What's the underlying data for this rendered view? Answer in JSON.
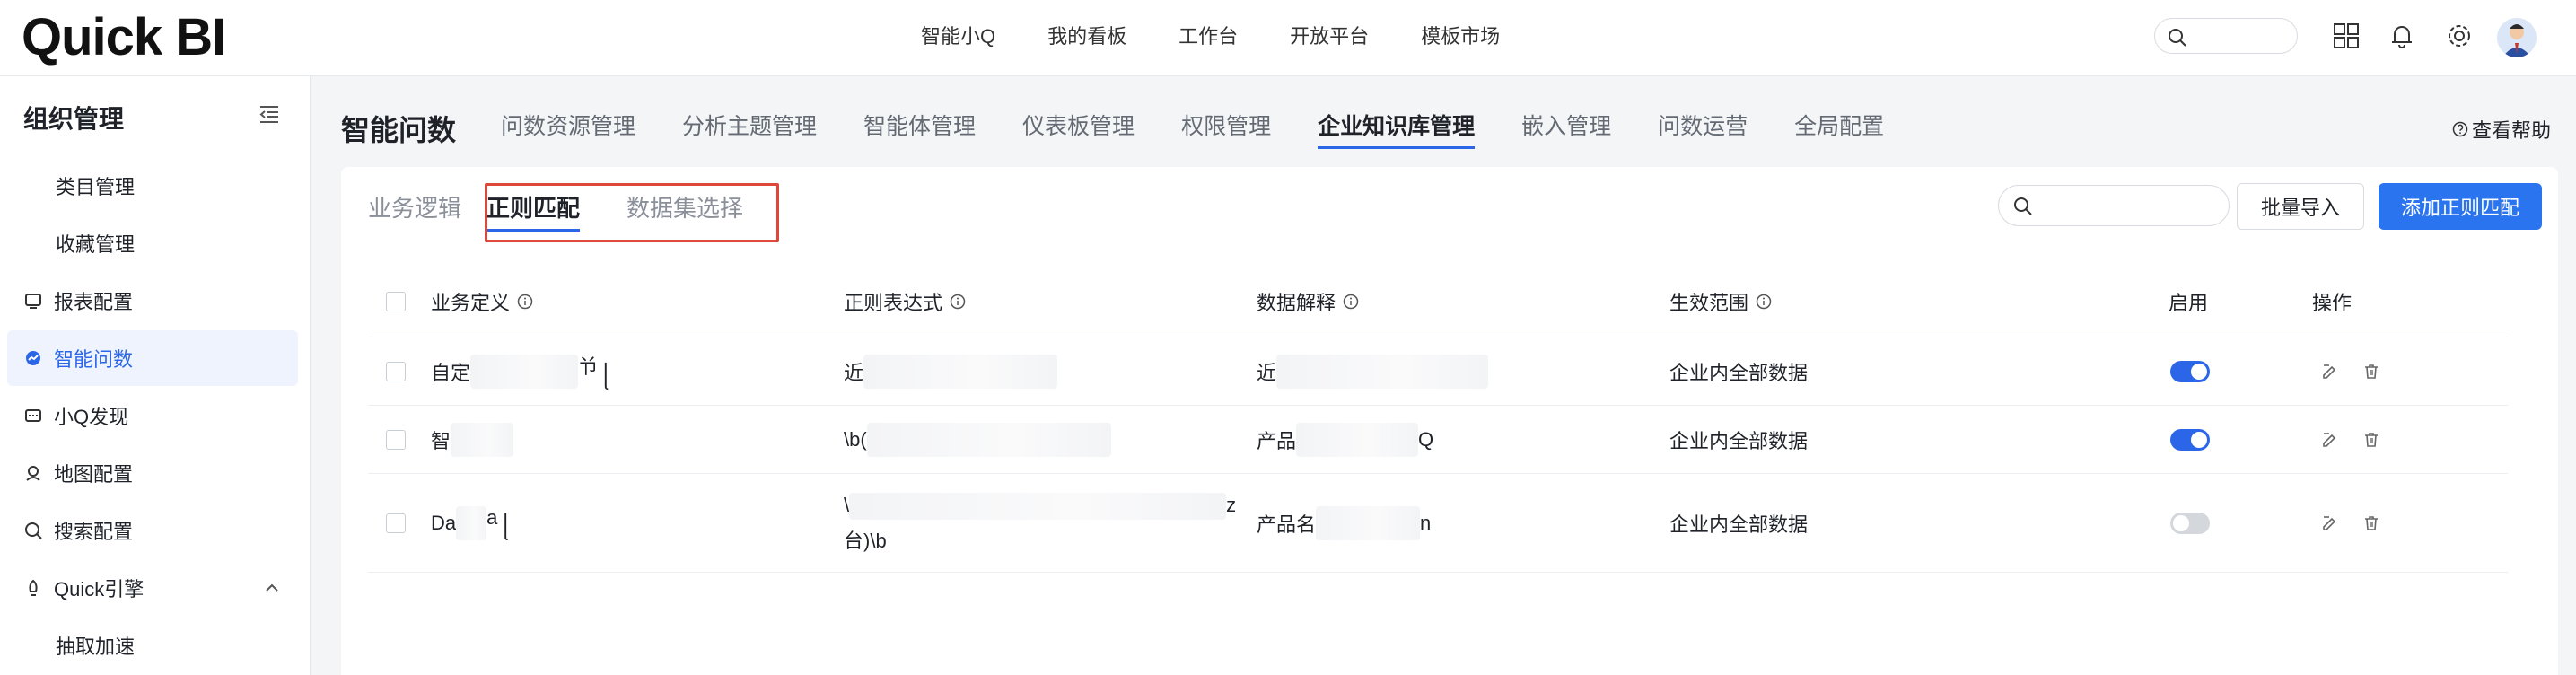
{
  "app": {
    "logo": "Quick BI"
  },
  "topnav": [
    "智能小Q",
    "我的看板",
    "工作台",
    "开放平台",
    "模板市场"
  ],
  "sidebar": {
    "title": "组织管理",
    "items": [
      {
        "label": "类目管理",
        "type": "sub"
      },
      {
        "label": "收藏管理",
        "type": "sub"
      },
      {
        "label": "报表配置",
        "icon": "report-icon"
      },
      {
        "label": "智能问数",
        "icon": "smart-query-icon",
        "active": true
      },
      {
        "label": "小Q发现",
        "icon": "discover-icon"
      },
      {
        "label": "地图配置",
        "icon": "map-icon"
      },
      {
        "label": "搜索配置",
        "icon": "search-config-icon"
      },
      {
        "label": "Quick引擎",
        "icon": "engine-icon",
        "expanded": true
      },
      {
        "label": "抽取加速",
        "type": "sub"
      }
    ]
  },
  "page": {
    "title": "智能问数",
    "tabs": [
      "问数资源管理",
      "分析主题管理",
      "智能体管理",
      "仪表板管理",
      "权限管理",
      "企业知识库管理",
      "嵌入管理",
      "问数运营",
      "全局配置"
    ],
    "active_tab": "企业知识库管理",
    "help": "查看帮助"
  },
  "card": {
    "subtabs": [
      "业务逻辑",
      "正则匹配",
      "数据集选择"
    ],
    "active_subtab": "正则匹配",
    "search_placeholder": "",
    "import_button": "批量导入",
    "add_button": "添加正则匹配"
  },
  "table": {
    "columns": [
      "业务定义",
      "正则表达式",
      "数据解释",
      "生效范围",
      "启用",
      "操作"
    ],
    "rows": [
      {
        "definition": "自定",
        "definition_tail": "兯 ꧊",
        "regex": "近",
        "explain": "近",
        "scope": "企业内全部数据",
        "enabled": true
      },
      {
        "definition": "智",
        "definition_tail": "",
        "regex": "\\b(",
        "explain": "产品",
        "explain_tail": "Q",
        "scope": "企业内全部数据",
        "enabled": true
      },
      {
        "definition": "Da",
        "definition_tail": "a ꧊",
        "regex": "\\",
        "regex_line2": "台)\\b",
        "regex_tail": "z",
        "explain": "产品名",
        "explain_tail": "n",
        "scope": "企业内全部数据",
        "enabled": false
      }
    ]
  },
  "colors": {
    "accent": "#2b66e8",
    "highlight": "#e0473b"
  }
}
